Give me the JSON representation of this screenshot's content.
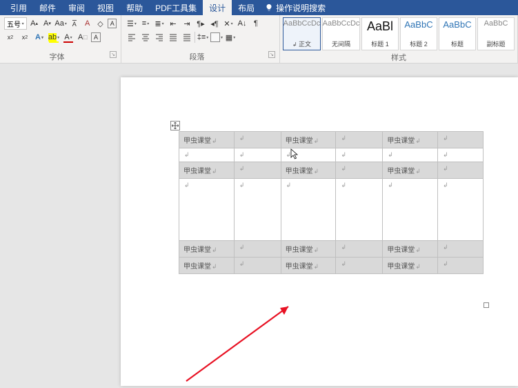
{
  "menu": {
    "items": [
      "引用",
      "邮件",
      "审阅",
      "视图",
      "帮助",
      "PDF工具集",
      "设计",
      "布局"
    ],
    "active_index": 6,
    "tellme": "操作说明搜索"
  },
  "font": {
    "group_label": "字体",
    "size": "五号"
  },
  "paragraph": {
    "group_label": "段落"
  },
  "styles": {
    "group_label": "样式",
    "items": [
      {
        "preview": "AaBbCcDc",
        "name": "正文",
        "cls": "gray",
        "selected": true
      },
      {
        "preview": "AaBbCcDc",
        "name": "无间隔",
        "cls": "gray",
        "selected": false
      },
      {
        "preview": "AaBl",
        "name": "标题 1",
        "cls": "big",
        "selected": false
      },
      {
        "preview": "AaBbC",
        "name": "标题 2",
        "cls": "head",
        "selected": false
      },
      {
        "preview": "AaBbC",
        "name": "标题",
        "cls": "head",
        "selected": false
      },
      {
        "preview": "AaBbC",
        "name": "副标题",
        "cls": "gray",
        "selected": false
      }
    ]
  },
  "table": {
    "cell_text": "甲虫课堂",
    "rows": [
      {
        "type": "header",
        "h": "h22"
      },
      {
        "type": "body",
        "h": "h18"
      },
      {
        "type": "header",
        "h": "h22"
      },
      {
        "type": "body",
        "h": "h90"
      },
      {
        "type": "header",
        "h": "h22"
      },
      {
        "type": "header",
        "h": "h22"
      }
    ],
    "col_pattern": [
      "text",
      "empty",
      "text",
      "empty",
      "text",
      "empty"
    ]
  }
}
